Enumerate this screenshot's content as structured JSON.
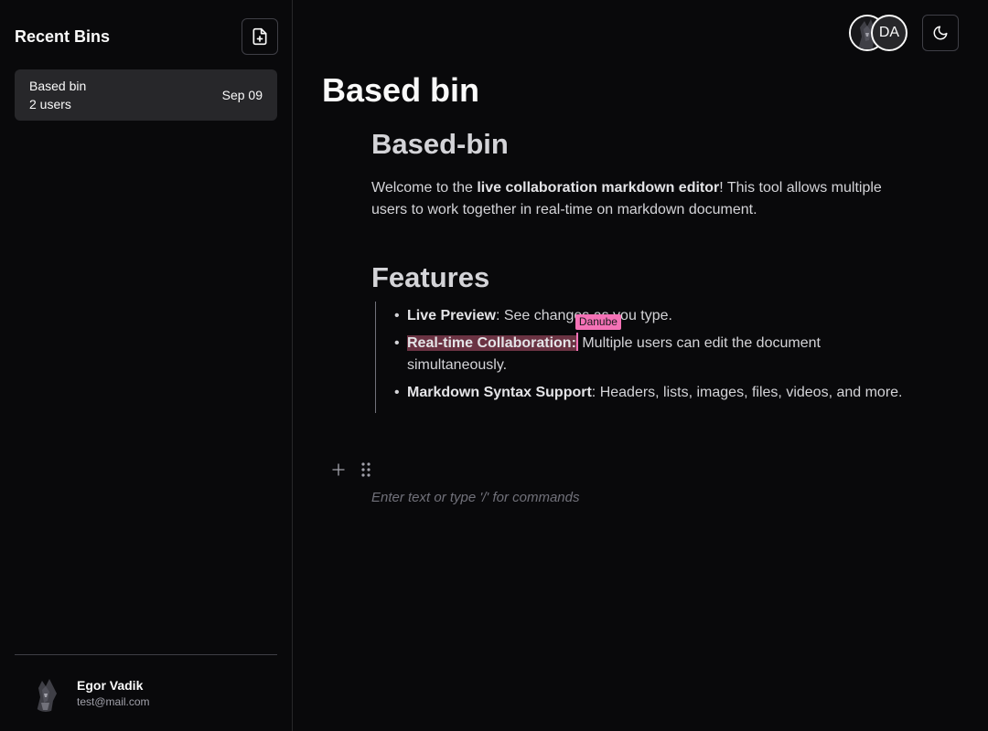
{
  "sidebar": {
    "title": "Recent Bins",
    "new_bin_icon": "file-plus-icon",
    "bins": [
      {
        "name": "Based bin",
        "users": "2 users",
        "date": "Sep 09"
      }
    ],
    "user": {
      "name": "Egor Vadik",
      "email": "test@mail.com"
    }
  },
  "topbar": {
    "collaborators": [
      {
        "type": "image",
        "icon": "user-photo"
      },
      {
        "type": "initials",
        "initials": "DA"
      }
    ],
    "theme_icon": "moon-icon"
  },
  "document": {
    "title": "Based bin",
    "heading1": "Based-bin",
    "intro": {
      "pre": "Welcome to the ",
      "bold": "live collaboration markdown editor",
      "post": "! This tool allows multiple users to work together in real-time on markdown document."
    },
    "heading2": "Features",
    "features": [
      {
        "bold": "Live Preview",
        "text": ": See changes as you type."
      },
      {
        "bold": "Real-time Collaboration:",
        "text": " Multiple users can edit the document simultaneously."
      },
      {
        "bold": "Markdown Syntax Support",
        "text": ": Headers, lists, images, files, videos, and more."
      }
    ],
    "remote_cursor": {
      "name": "Danube",
      "color": "#f472b6"
    },
    "placeholder": "Enter text or type '/' for commands"
  },
  "colors": {
    "background": "#09090b",
    "panel": "#27272a",
    "cursor": "#f472b6",
    "highlight": "#6b3343"
  }
}
